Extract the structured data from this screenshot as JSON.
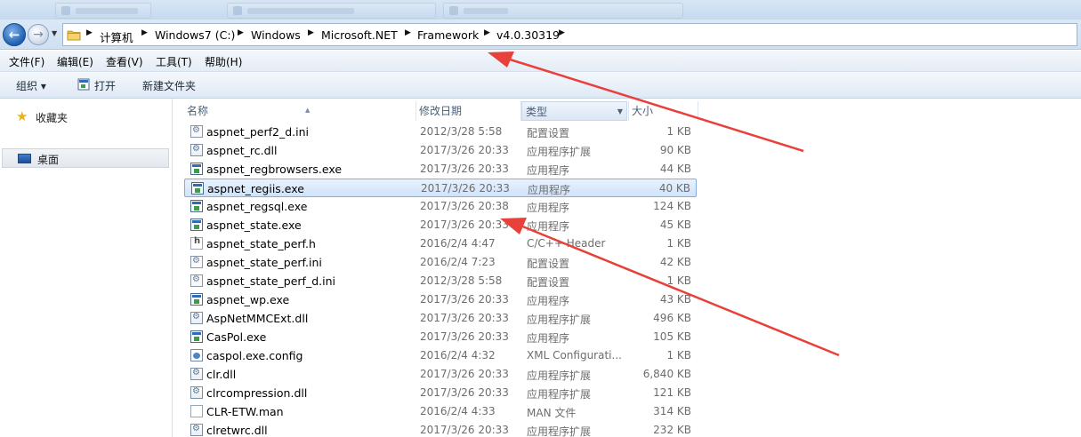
{
  "address": {
    "crumbs": [
      "计算机",
      "Windows7 (C:)",
      "Windows",
      "Microsoft.NET",
      "Framework",
      "v4.0.30319"
    ]
  },
  "menu": [
    "文件(F)",
    "编辑(E)",
    "查看(V)",
    "工具(T)",
    "帮助(H)"
  ],
  "toolbar": {
    "organize": "组织 ▾",
    "open": "打开",
    "new_folder": "新建文件夹"
  },
  "nav": {
    "favorites": "收藏夹",
    "desktop": "桌面"
  },
  "columns": {
    "name": "名称",
    "date": "修改日期",
    "type": "类型",
    "size": "大小"
  },
  "files": [
    {
      "name": "aspnet_perf2_d.ini",
      "date": "2012/3/28 5:58",
      "type": "配置设置",
      "size": "1 KB",
      "icon": "ini"
    },
    {
      "name": "aspnet_rc.dll",
      "date": "2017/3/26 20:33",
      "type": "应用程序扩展",
      "size": "90 KB",
      "icon": "dll"
    },
    {
      "name": "aspnet_regbrowsers.exe",
      "date": "2017/3/26 20:33",
      "type": "应用程序",
      "size": "44 KB",
      "icon": "exe"
    },
    {
      "name": "aspnet_regiis.exe",
      "date": "2017/3/26 20:33",
      "type": "应用程序",
      "size": "40 KB",
      "icon": "exe",
      "selected": true
    },
    {
      "name": "aspnet_regsql.exe",
      "date": "2017/3/26 20:38",
      "type": "应用程序",
      "size": "124 KB",
      "icon": "exe"
    },
    {
      "name": "aspnet_state.exe",
      "date": "2017/3/26 20:33",
      "type": "应用程序",
      "size": "45 KB",
      "icon": "exe"
    },
    {
      "name": "aspnet_state_perf.h",
      "date": "2016/2/4 4:47",
      "type": "C/C++ Header",
      "size": "1 KB",
      "icon": "h"
    },
    {
      "name": "aspnet_state_perf.ini",
      "date": "2016/2/4 7:23",
      "type": "配置设置",
      "size": "42 KB",
      "icon": "ini"
    },
    {
      "name": "aspnet_state_perf_d.ini",
      "date": "2012/3/28 5:58",
      "type": "配置设置",
      "size": "1 KB",
      "icon": "ini"
    },
    {
      "name": "aspnet_wp.exe",
      "date": "2017/3/26 20:33",
      "type": "应用程序",
      "size": "43 KB",
      "icon": "exe"
    },
    {
      "name": "AspNetMMCExt.dll",
      "date": "2017/3/26 20:33",
      "type": "应用程序扩展",
      "size": "496 KB",
      "icon": "dll"
    },
    {
      "name": "CasPol.exe",
      "date": "2017/3/26 20:33",
      "type": "应用程序",
      "size": "105 KB",
      "icon": "exe"
    },
    {
      "name": "caspol.exe.config",
      "date": "2016/2/4 4:32",
      "type": "XML Configurati...",
      "size": "1 KB",
      "icon": "config"
    },
    {
      "name": "clr.dll",
      "date": "2017/3/26 20:33",
      "type": "应用程序扩展",
      "size": "6,840 KB",
      "icon": "dll"
    },
    {
      "name": "clrcompression.dll",
      "date": "2017/3/26 20:33",
      "type": "应用程序扩展",
      "size": "121 KB",
      "icon": "dll"
    },
    {
      "name": "CLR-ETW.man",
      "date": "2016/2/4 4:33",
      "type": "MAN 文件",
      "size": "314 KB",
      "icon": "file"
    },
    {
      "name": "clretwrc.dll",
      "date": "2017/3/26 20:33",
      "type": "应用程序扩展",
      "size": "232 KB",
      "icon": "dll"
    }
  ],
  "colors": {
    "accent": "#2f6bb6",
    "selection_border": "#84acdd",
    "annotation_arrow": "#e8403a"
  }
}
